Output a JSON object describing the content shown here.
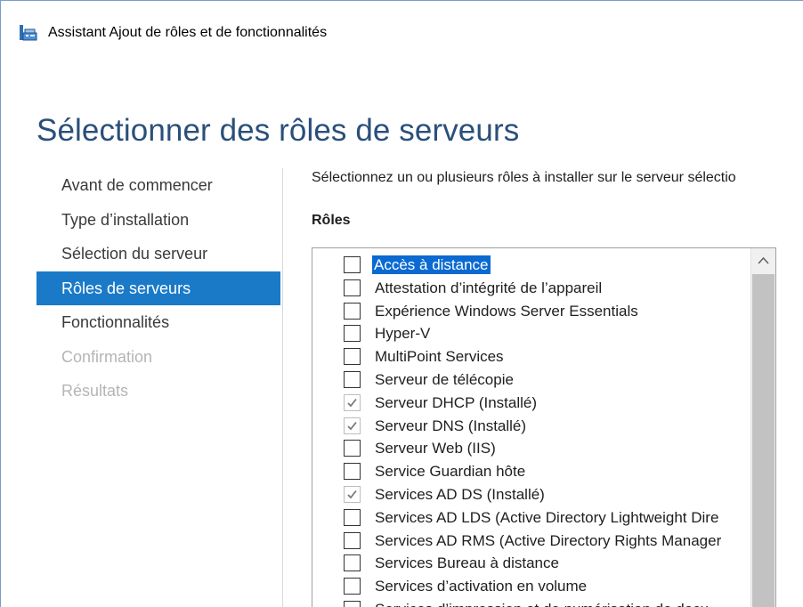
{
  "window": {
    "title": "Assistant Ajout de rôles et de fonctionnalités",
    "icon": "server-manager-wizard-icon"
  },
  "page": {
    "title": "Sélectionner des rôles de serveurs"
  },
  "nav": {
    "items": [
      {
        "label": "Avant de commencer",
        "state": "normal"
      },
      {
        "label": "Type d’installation",
        "state": "normal"
      },
      {
        "label": "Sélection du serveur",
        "state": "normal"
      },
      {
        "label": "Rôles de serveurs",
        "state": "active"
      },
      {
        "label": "Fonctionnalités",
        "state": "normal"
      },
      {
        "label": "Confirmation",
        "state": "disabled"
      },
      {
        "label": "Résultats",
        "state": "disabled"
      }
    ]
  },
  "main": {
    "instruction": "Sélectionnez un ou plusieurs rôles à installer sur le serveur sélectio",
    "roles_heading": "Rôles",
    "roles": [
      {
        "label": "Accès à distance",
        "checked": false,
        "selected": true
      },
      {
        "label": "Attestation d’intégrité de l’appareil",
        "checked": false
      },
      {
        "label": "Expérience Windows Server Essentials",
        "checked": false
      },
      {
        "label": "Hyper-V",
        "checked": false
      },
      {
        "label": "MultiPoint Services",
        "checked": false
      },
      {
        "label": "Serveur de télécopie",
        "checked": false
      },
      {
        "label": "Serveur DHCP (Installé)",
        "checked": true
      },
      {
        "label": "Serveur DNS (Installé)",
        "checked": true
      },
      {
        "label": "Serveur Web (IIS)",
        "checked": false
      },
      {
        "label": "Service Guardian hôte",
        "checked": false
      },
      {
        "label": "Services AD DS (Installé)",
        "checked": true,
        "highlighted": true
      },
      {
        "label": "Services AD LDS (Active Directory Lightweight Dire",
        "checked": false
      },
      {
        "label": "Services AD RMS (Active Directory Rights Manager",
        "checked": false
      },
      {
        "label": "Services Bureau à distance",
        "checked": false
      },
      {
        "label": "Services d’activation en volume",
        "checked": false
      },
      {
        "label": "Services d’impression et de numérisation de docu",
        "checked": false
      }
    ]
  },
  "colors": {
    "accent": "#1a7ac8",
    "title": "#2a4f7a",
    "highlight": "#f7f72a",
    "selection": "#0a6ad1"
  }
}
